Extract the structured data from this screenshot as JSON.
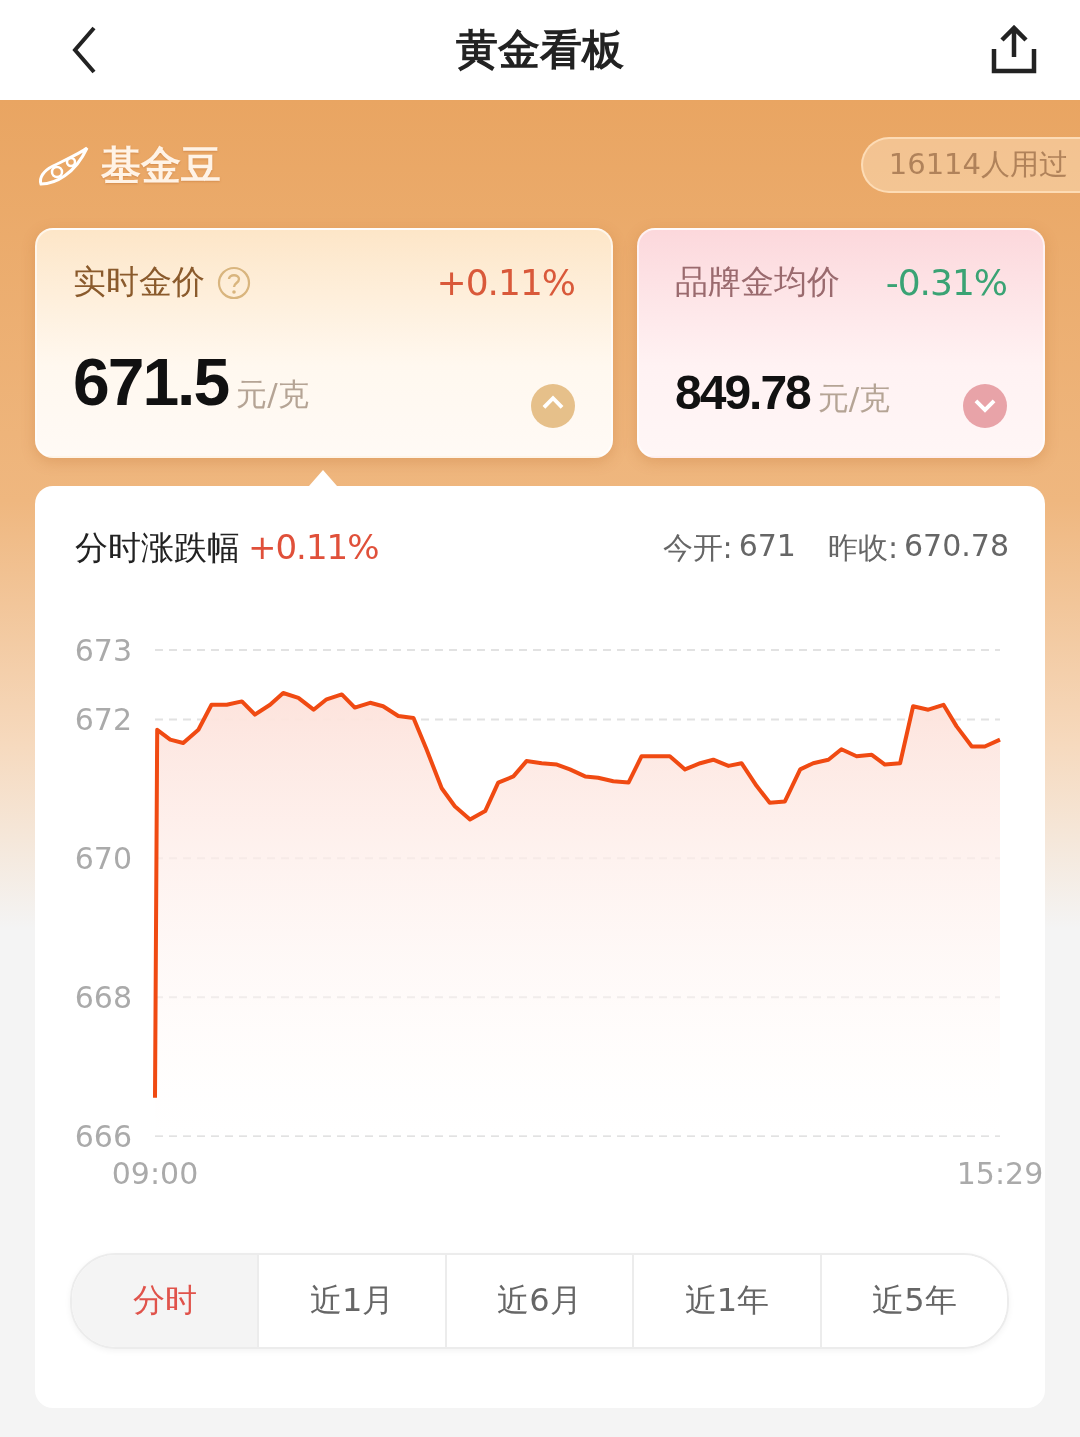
{
  "header": {
    "title": "黄金看板"
  },
  "brand": {
    "name": "基金豆",
    "badge": "16114人用过"
  },
  "cards": [
    {
      "label": "实时金价",
      "help": true,
      "change": "+0.11%",
      "price": "671.5",
      "unit": "元/克",
      "kind": "up",
      "selected": true
    },
    {
      "label": "品牌金均价",
      "help": false,
      "change": "-0.31%",
      "price": "849.78",
      "unit": "元/克",
      "kind": "down",
      "selected": false
    }
  ],
  "chart_panel": {
    "title": "分时涨跌幅",
    "change": "+0.11%",
    "open_label": "今开:",
    "open_value": "671",
    "prev_label": "昨收:",
    "prev_value": "670.78",
    "chart_data": {
      "type": "line",
      "grid": true,
      "ylim": [
        666,
        673
      ],
      "yticks": [
        666,
        668,
        670,
        672,
        673
      ],
      "xlim": [
        540,
        929
      ],
      "xticks": [
        {
          "value": 540,
          "label": "09:00"
        },
        {
          "value": 929,
          "label": "15:29"
        }
      ],
      "x": [
        540,
        541,
        547,
        553,
        560,
        566,
        573,
        580,
        586,
        593,
        599,
        606,
        613,
        619,
        626,
        632,
        639,
        645,
        652,
        659,
        665,
        672,
        678,
        685,
        692,
        698,
        705,
        711,
        718,
        725,
        731,
        738,
        744,
        751,
        758,
        764,
        771,
        777,
        784,
        791,
        797,
        804,
        810,
        817,
        823,
        830,
        837,
        843,
        850,
        856,
        863,
        870,
        876,
        883,
        889,
        896,
        903,
        909,
        916,
        922,
        929
      ],
      "series": [
        {
          "color": "#f04a12",
          "values": [
            666.55,
            671.85,
            671.71,
            671.66,
            671.85,
            672.21,
            672.21,
            672.26,
            672.07,
            672.21,
            672.38,
            672.31,
            672.14,
            672.29,
            672.36,
            672.17,
            672.24,
            672.19,
            672.05,
            672.02,
            671.57,
            671.01,
            670.75,
            670.56,
            670.68,
            671.09,
            671.18,
            671.4,
            671.37,
            671.35,
            671.28,
            671.18,
            671.16,
            671.11,
            671.09,
            671.47,
            671.47,
            671.47,
            671.28,
            671.37,
            671.42,
            671.33,
            671.37,
            671.04,
            670.8,
            670.82,
            671.28,
            671.37,
            671.42,
            671.57,
            671.47,
            671.49,
            671.35,
            671.37,
            672.19,
            672.14,
            672.21,
            671.9,
            671.61,
            671.61,
            671.71
          ]
        }
      ]
    }
  },
  "range_tabs": [
    {
      "label": "分时",
      "selected": true
    },
    {
      "label": "近1月",
      "selected": false
    },
    {
      "label": "近6月",
      "selected": false
    },
    {
      "label": "近1年",
      "selected": false
    },
    {
      "label": "近5年",
      "selected": false
    }
  ]
}
